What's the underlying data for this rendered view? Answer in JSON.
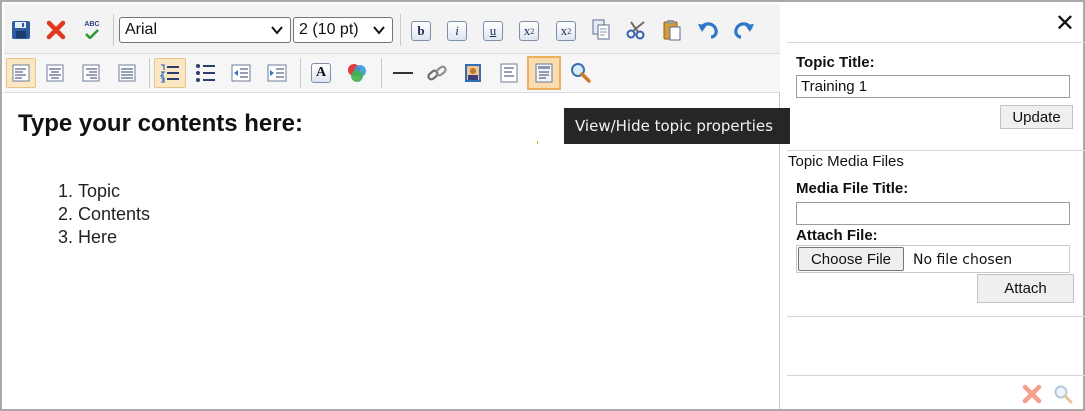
{
  "toolbar": {
    "font_select": {
      "value": "Arial"
    },
    "size_select": {
      "value": "2 (10 pt)"
    },
    "row1_icons": [
      "save-icon",
      "cancel-icon",
      "spell-check-icon",
      "bold-icon",
      "italic-icon",
      "underline-icon",
      "subscript-icon",
      "superscript-icon",
      "copy-icon",
      "cut-icon",
      "paste-icon",
      "undo-icon",
      "redo-icon"
    ],
    "row2_icons": [
      "align-left-icon",
      "align-center-icon",
      "align-right-icon",
      "justify-icon",
      "ordered-list-icon",
      "unordered-list-icon",
      "outdent-icon",
      "indent-icon",
      "font-color-icon",
      "highlight-color-icon",
      "horizontal-rule-icon",
      "link-icon",
      "image-icon",
      "template-icon",
      "topic-properties-icon",
      "find-icon"
    ],
    "glyphs": {
      "bold": "b",
      "italic": "i",
      "underline": "u",
      "subscript": "x",
      "subscript_mark": "2",
      "superscript": "x",
      "superscript_mark": "2",
      "spell": "ABC",
      "font_color": "A"
    }
  },
  "editor": {
    "heading": "Type your contents here:",
    "list_items": [
      "Topic",
      "Contents",
      "Here"
    ]
  },
  "tooltip": {
    "text": "View/Hide topic properties"
  },
  "panel": {
    "close_label": "✕",
    "topic_title_label": "Topic Title:",
    "topic_title_value": "Training 1",
    "update_button": "Update",
    "media_section_label": "Topic Media Files",
    "media_file_title_label": "Media File Title:",
    "media_file_title_value": "",
    "attach_file_label": "Attach File:",
    "choose_file_button": "Choose File",
    "file_status": "No file chosen",
    "attach_button": "Attach",
    "footer_icons": [
      "delete-icon",
      "preview-icon"
    ]
  },
  "colors": {
    "active_button_bg": "#fbe7c3",
    "tooltip_bg": "#262626",
    "delete_icon": "#f4a08c",
    "toolbar_bg": "#f3f3f3"
  }
}
